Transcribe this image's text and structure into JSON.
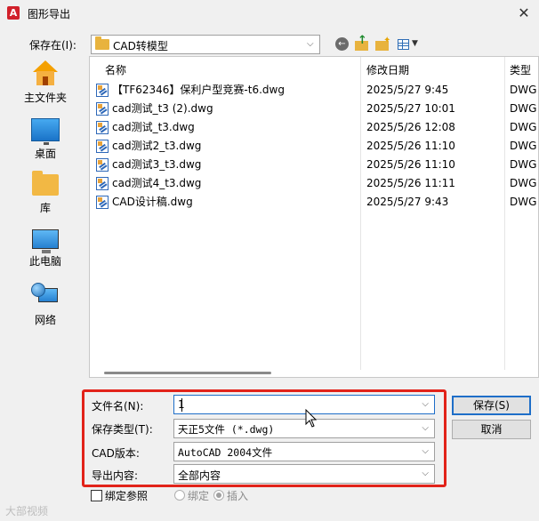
{
  "window": {
    "title": "图形导出",
    "app_icon_letter": "A",
    "close_glyph": "✕"
  },
  "location": {
    "label": "保存在(I):",
    "value": "CAD转模型"
  },
  "toolbar": {
    "icons": [
      "back-icon",
      "up-folder-icon",
      "new-folder-icon",
      "views-icon"
    ]
  },
  "places": [
    {
      "label": "主文件夹",
      "icon": "home-icon"
    },
    {
      "label": "桌面",
      "icon": "desktop-icon"
    },
    {
      "label": "库",
      "icon": "library-icon"
    },
    {
      "label": "此电脑",
      "icon": "computer-icon"
    },
    {
      "label": "网络",
      "icon": "network-icon"
    }
  ],
  "file_list": {
    "columns": {
      "name": "名称",
      "date": "修改日期",
      "type": "类型"
    },
    "files": [
      {
        "name": "【TF62346】保利户型竞赛-t6.dwg",
        "date": "2025/5/27 9:45",
        "type": "DWG"
      },
      {
        "name": "cad测试_t3 (2).dwg",
        "date": "2025/5/27 10:01",
        "type": "DWG"
      },
      {
        "name": "cad测试_t3.dwg",
        "date": "2025/5/26 12:08",
        "type": "DWG"
      },
      {
        "name": "cad测试2_t3.dwg",
        "date": "2025/5/26 11:10",
        "type": "DWG"
      },
      {
        "name": "cad测试3_t3.dwg",
        "date": "2025/5/26 11:10",
        "type": "DWG"
      },
      {
        "name": "cad测试4_t3.dwg",
        "date": "2025/5/26 11:11",
        "type": "DWG"
      },
      {
        "name": "CAD设计稿.dwg",
        "date": "2025/5/27 9:43",
        "type": "DWG"
      }
    ]
  },
  "form": {
    "filename_label": "文件名(N):",
    "filename_value": "1",
    "filetype_label": "保存类型(T):",
    "filetype_value": "天正5文件 (*.dwg)",
    "version_label": "CAD版本:",
    "version_value": "AutoCAD 2004文件",
    "export_label": "导出内容:",
    "export_value": "全部内容"
  },
  "buttons": {
    "save": "保存(S)",
    "cancel": "取消"
  },
  "options": {
    "bind_xref": "绑定参照",
    "radio_bind": "绑定",
    "radio_insert": "插入"
  },
  "watermark": "大部视频",
  "colors": {
    "highlight_border": "#e2231a",
    "focus_blue": "#1e6ec8"
  }
}
